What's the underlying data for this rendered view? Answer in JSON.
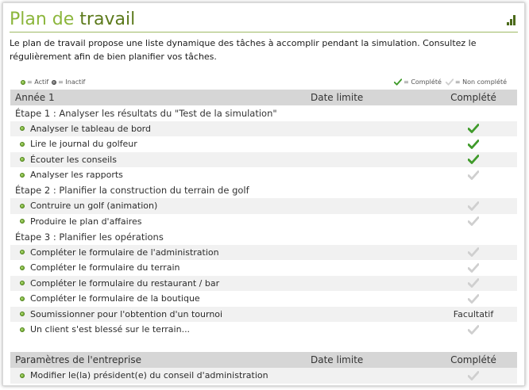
{
  "page": {
    "title_part1": "Plan de",
    "title_part2": "travail",
    "intro": "Le plan de travail propose une liste dynamique des tâches à accomplir pendant la simulation. Consultez le régulièrement afin de bien planifier vos tâches."
  },
  "legend": {
    "active": "= Actif",
    "inactive": "= Inactif",
    "complete": "= Complété",
    "not_complete": "= Non complété"
  },
  "colors": {
    "check_done": "#3f9a2a",
    "check_pending": "#cfcfcf",
    "accent": "#8cb63c"
  },
  "year_table": {
    "header": {
      "name": "Année 1",
      "deadline": "Date limite",
      "done": "Complété"
    },
    "stage1": "Étape 1 : Analyser les résultats du \"Test de la simulation\"",
    "stage2": "Étape 2 : Planifier la construction du terrain de golf",
    "stage3": "Étape 3 : Planifier les opérations",
    "tasks": [
      {
        "label": "Analyser le tableau de bord",
        "status": "complete"
      },
      {
        "label": "Lire le journal du golfeur",
        "status": "complete"
      },
      {
        "label": "Écouter les conseils",
        "status": "complete"
      },
      {
        "label": "Analyser les rapports",
        "status": "not_complete"
      },
      {
        "label": "Contruire un golf (animation)",
        "status": "not_complete"
      },
      {
        "label": "Produire le plan d'affaires",
        "status": "not_complete"
      },
      {
        "label": "Compléter le formulaire de l'administration",
        "status": "not_complete"
      },
      {
        "label": "Compléter le formulaire du terrain",
        "status": "not_complete"
      },
      {
        "label": "Compléter le formulaire du restaurant / bar",
        "status": "not_complete"
      },
      {
        "label": "Compléter le formulaire de la boutique",
        "status": "not_complete"
      },
      {
        "label": "Soumissionner pour l'obtention d'un tournoi",
        "status": "optional",
        "status_text": "Facultatif"
      },
      {
        "label": "Un client s'est blessé sur le terrain...",
        "status": "not_complete"
      }
    ]
  },
  "company_table": {
    "header": {
      "name": "Paramètres de l'entreprise",
      "deadline": "Date limite",
      "done": "Complété"
    },
    "tasks": [
      {
        "label": "Modifier le(la) président(e) du conseil d'administration",
        "status": "not_complete"
      }
    ]
  }
}
